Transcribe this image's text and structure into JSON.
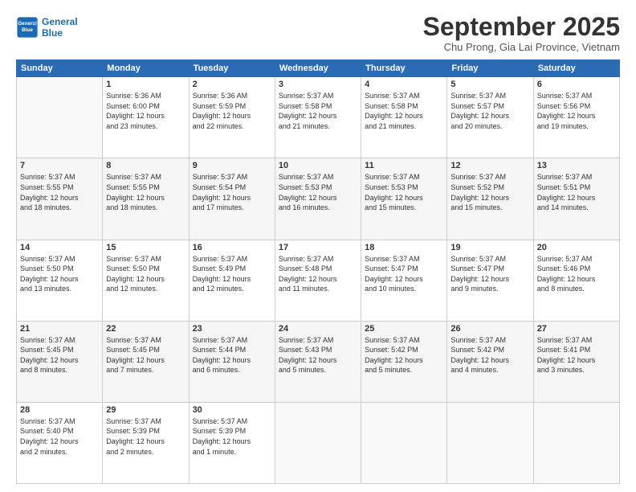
{
  "header": {
    "logo_line1": "General",
    "logo_line2": "Blue",
    "month": "September 2025",
    "location": "Chu Prong, Gia Lai Province, Vietnam"
  },
  "days_of_week": [
    "Sunday",
    "Monday",
    "Tuesday",
    "Wednesday",
    "Thursday",
    "Friday",
    "Saturday"
  ],
  "weeks": [
    [
      {
        "day": "",
        "info": ""
      },
      {
        "day": "1",
        "info": "Sunrise: 5:36 AM\nSunset: 6:00 PM\nDaylight: 12 hours\nand 23 minutes."
      },
      {
        "day": "2",
        "info": "Sunrise: 5:36 AM\nSunset: 5:59 PM\nDaylight: 12 hours\nand 22 minutes."
      },
      {
        "day": "3",
        "info": "Sunrise: 5:37 AM\nSunset: 5:58 PM\nDaylight: 12 hours\nand 21 minutes."
      },
      {
        "day": "4",
        "info": "Sunrise: 5:37 AM\nSunset: 5:58 PM\nDaylight: 12 hours\nand 21 minutes."
      },
      {
        "day": "5",
        "info": "Sunrise: 5:37 AM\nSunset: 5:57 PM\nDaylight: 12 hours\nand 20 minutes."
      },
      {
        "day": "6",
        "info": "Sunrise: 5:37 AM\nSunset: 5:56 PM\nDaylight: 12 hours\nand 19 minutes."
      }
    ],
    [
      {
        "day": "7",
        "info": "Sunrise: 5:37 AM\nSunset: 5:55 PM\nDaylight: 12 hours\nand 18 minutes."
      },
      {
        "day": "8",
        "info": "Sunrise: 5:37 AM\nSunset: 5:55 PM\nDaylight: 12 hours\nand 18 minutes."
      },
      {
        "day": "9",
        "info": "Sunrise: 5:37 AM\nSunset: 5:54 PM\nDaylight: 12 hours\nand 17 minutes."
      },
      {
        "day": "10",
        "info": "Sunrise: 5:37 AM\nSunset: 5:53 PM\nDaylight: 12 hours\nand 16 minutes."
      },
      {
        "day": "11",
        "info": "Sunrise: 5:37 AM\nSunset: 5:53 PM\nDaylight: 12 hours\nand 15 minutes."
      },
      {
        "day": "12",
        "info": "Sunrise: 5:37 AM\nSunset: 5:52 PM\nDaylight: 12 hours\nand 15 minutes."
      },
      {
        "day": "13",
        "info": "Sunrise: 5:37 AM\nSunset: 5:51 PM\nDaylight: 12 hours\nand 14 minutes."
      }
    ],
    [
      {
        "day": "14",
        "info": "Sunrise: 5:37 AM\nSunset: 5:50 PM\nDaylight: 12 hours\nand 13 minutes."
      },
      {
        "day": "15",
        "info": "Sunrise: 5:37 AM\nSunset: 5:50 PM\nDaylight: 12 hours\nand 12 minutes."
      },
      {
        "day": "16",
        "info": "Sunrise: 5:37 AM\nSunset: 5:49 PM\nDaylight: 12 hours\nand 12 minutes."
      },
      {
        "day": "17",
        "info": "Sunrise: 5:37 AM\nSunset: 5:48 PM\nDaylight: 12 hours\nand 11 minutes."
      },
      {
        "day": "18",
        "info": "Sunrise: 5:37 AM\nSunset: 5:47 PM\nDaylight: 12 hours\nand 10 minutes."
      },
      {
        "day": "19",
        "info": "Sunrise: 5:37 AM\nSunset: 5:47 PM\nDaylight: 12 hours\nand 9 minutes."
      },
      {
        "day": "20",
        "info": "Sunrise: 5:37 AM\nSunset: 5:46 PM\nDaylight: 12 hours\nand 8 minutes."
      }
    ],
    [
      {
        "day": "21",
        "info": "Sunrise: 5:37 AM\nSunset: 5:45 PM\nDaylight: 12 hours\nand 8 minutes."
      },
      {
        "day": "22",
        "info": "Sunrise: 5:37 AM\nSunset: 5:45 PM\nDaylight: 12 hours\nand 7 minutes."
      },
      {
        "day": "23",
        "info": "Sunrise: 5:37 AM\nSunset: 5:44 PM\nDaylight: 12 hours\nand 6 minutes."
      },
      {
        "day": "24",
        "info": "Sunrise: 5:37 AM\nSunset: 5:43 PM\nDaylight: 12 hours\nand 5 minutes."
      },
      {
        "day": "25",
        "info": "Sunrise: 5:37 AM\nSunset: 5:42 PM\nDaylight: 12 hours\nand 5 minutes."
      },
      {
        "day": "26",
        "info": "Sunrise: 5:37 AM\nSunset: 5:42 PM\nDaylight: 12 hours\nand 4 minutes."
      },
      {
        "day": "27",
        "info": "Sunrise: 5:37 AM\nSunset: 5:41 PM\nDaylight: 12 hours\nand 3 minutes."
      }
    ],
    [
      {
        "day": "28",
        "info": "Sunrise: 5:37 AM\nSunset: 5:40 PM\nDaylight: 12 hours\nand 2 minutes."
      },
      {
        "day": "29",
        "info": "Sunrise: 5:37 AM\nSunset: 5:39 PM\nDaylight: 12 hours\nand 2 minutes."
      },
      {
        "day": "30",
        "info": "Sunrise: 5:37 AM\nSunset: 5:39 PM\nDaylight: 12 hours\nand 1 minute."
      },
      {
        "day": "",
        "info": ""
      },
      {
        "day": "",
        "info": ""
      },
      {
        "day": "",
        "info": ""
      },
      {
        "day": "",
        "info": ""
      }
    ]
  ]
}
